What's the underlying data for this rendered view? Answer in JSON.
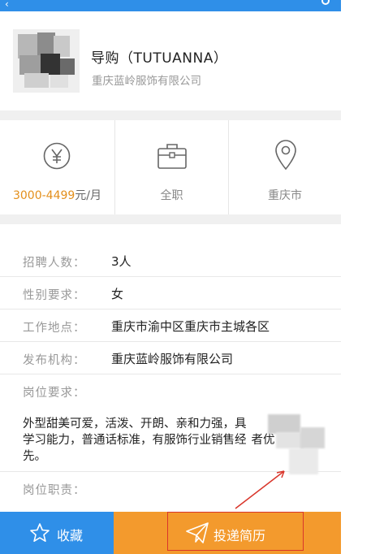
{
  "job": {
    "title": "导购（TUTUANNA）",
    "company": "重庆蓝岭服饰有限公司"
  },
  "summary": {
    "salary_range": "3000-4499",
    "salary_unit": "元/月",
    "job_type": "全职",
    "city": "重庆市"
  },
  "details": [
    {
      "label": "招聘人数：",
      "value": "3人"
    },
    {
      "label": "性别要求：",
      "value": "女"
    },
    {
      "label": "工作地点：",
      "value": "重庆市渝中区重庆市主城各区"
    },
    {
      "label": "发布机构：",
      "value": "重庆蓝岭服饰有限公司"
    }
  ],
  "requirements": {
    "label": "岗位要求：",
    "line1": "外型甜美可爱，活泼、开朗、亲和力强，具",
    "line1_tail": "强的",
    "line2": "学习能力，普通话标准，有服饰行业销售经",
    "line2_tail": "者优",
    "line3": "先。"
  },
  "responsibilities": {
    "label": "岗位职责："
  },
  "actions": {
    "favorite_label": "收藏",
    "apply_label": "投递简历"
  },
  "icons": {
    "salary": "yen-icon",
    "job_type": "briefcase-icon",
    "location": "location-pin-icon",
    "favorite": "star-icon",
    "apply": "paper-plane-icon"
  },
  "colors": {
    "primary_blue": "#2f8fe8",
    "accent_orange": "#f39a2d",
    "salary_orange": "#e38f1c"
  }
}
